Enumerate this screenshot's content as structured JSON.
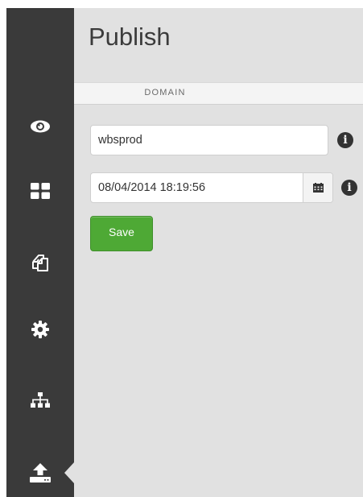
{
  "sidebar": {
    "items": [
      {
        "icon": "eye-icon",
        "label": "preview"
      },
      {
        "icon": "grid-icon",
        "label": "layout"
      },
      {
        "icon": "copy-icon",
        "label": "content"
      },
      {
        "icon": "gear-icon",
        "label": "settings"
      },
      {
        "icon": "sitemap-icon",
        "label": "structure"
      },
      {
        "icon": "upload-icon",
        "label": "publish",
        "active": true
      }
    ]
  },
  "page": {
    "title": "Publish"
  },
  "section": {
    "header": "DOMAIN"
  },
  "form": {
    "domain_value": "wbsprod",
    "datetime_value": "08/04/2014 18:19:56",
    "save_label": "Save",
    "info_glyph": "i"
  },
  "colors": {
    "sidebar_bg": "#3a3a3a",
    "content_bg": "#e1e1e1",
    "save_button": "#4ea935"
  }
}
